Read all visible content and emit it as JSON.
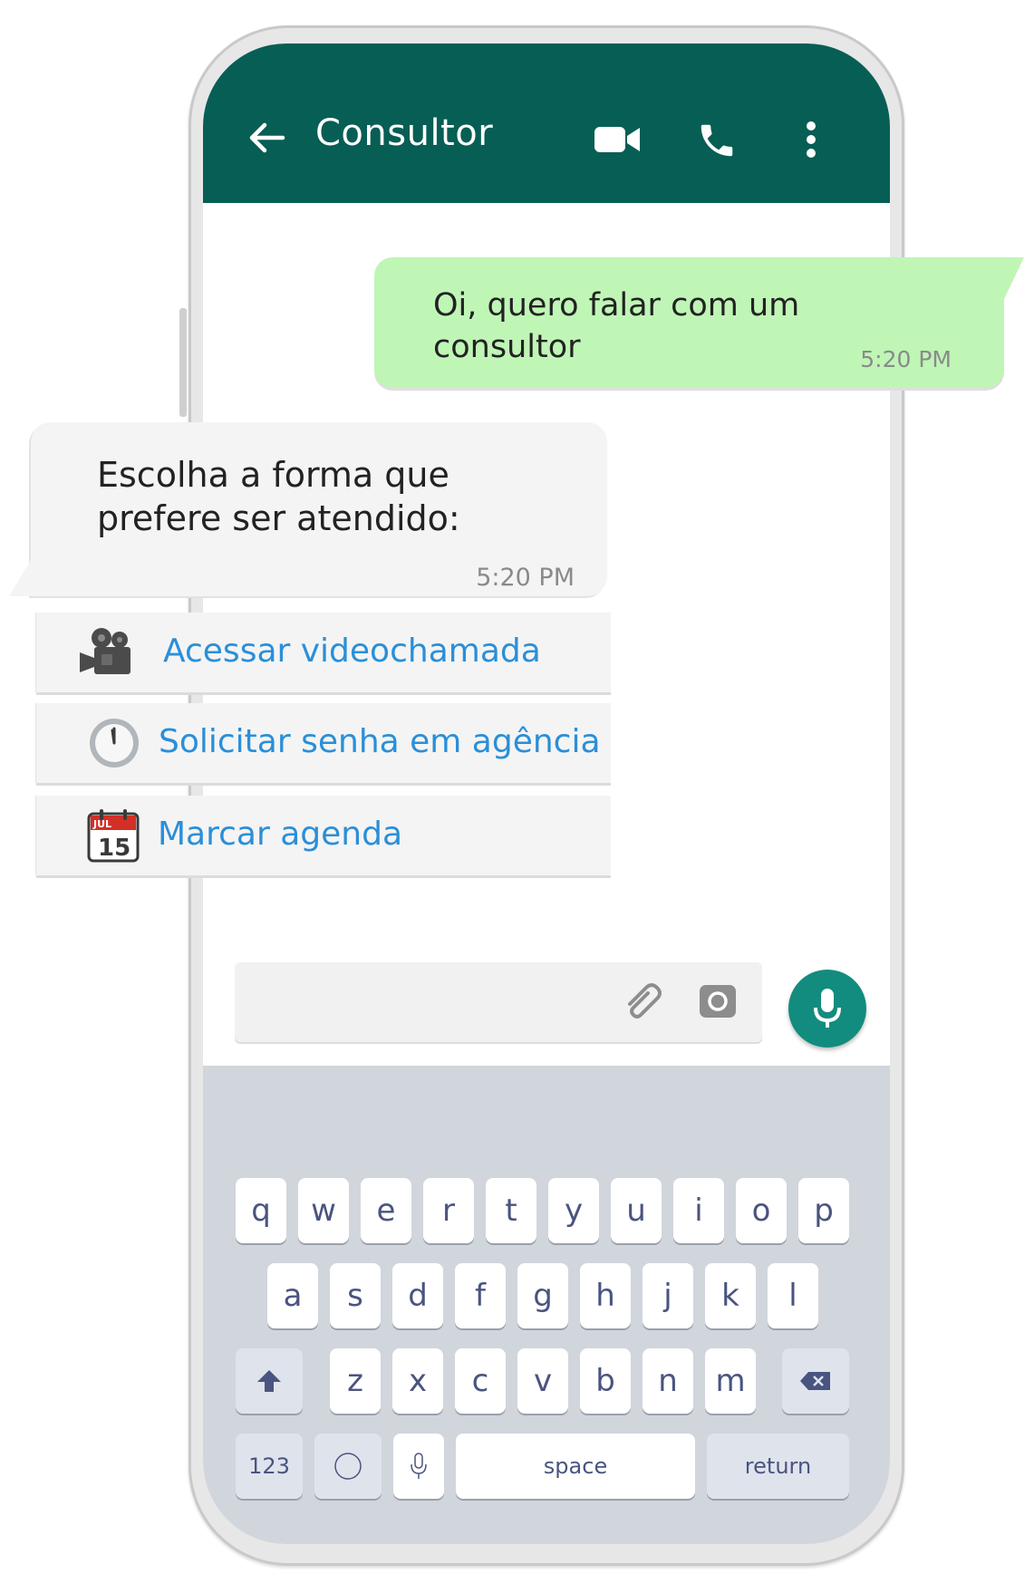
{
  "header": {
    "title": "Consultor"
  },
  "messages": {
    "outgoing": {
      "text_line1": "Oi, quero falar com um",
      "text_line2": "consultor",
      "time": "5:20 PM"
    },
    "incoming": {
      "text_line1": "Escolha a forma que",
      "text_line2": "prefere ser atendido:",
      "time": "5:20 PM"
    }
  },
  "options": [
    {
      "label": "Acessar videochamada",
      "icon": "movie-camera-icon"
    },
    {
      "label": "Solicitar senha em agência",
      "icon": "clock-icon"
    },
    {
      "label": "Marcar agenda",
      "icon": "calendar-icon",
      "calendar_month": "JUL",
      "calendar_day": "15"
    }
  ],
  "keyboard": {
    "row1": [
      "q",
      "w",
      "e",
      "r",
      "t",
      "y",
      "u",
      "i",
      "o",
      "p"
    ],
    "row2": [
      "a",
      "s",
      "d",
      "f",
      "g",
      "h",
      "j",
      "k",
      "l"
    ],
    "row3": [
      "z",
      "x",
      "c",
      "v",
      "b",
      "n",
      "m"
    ],
    "numbers_label": "123",
    "space_label": "space",
    "return_label": "return"
  },
  "colors": {
    "appbar": "#075e54",
    "outgoing_bubble": "#bff6b6",
    "accent": "#128c7e",
    "link": "#2a8fd8"
  }
}
